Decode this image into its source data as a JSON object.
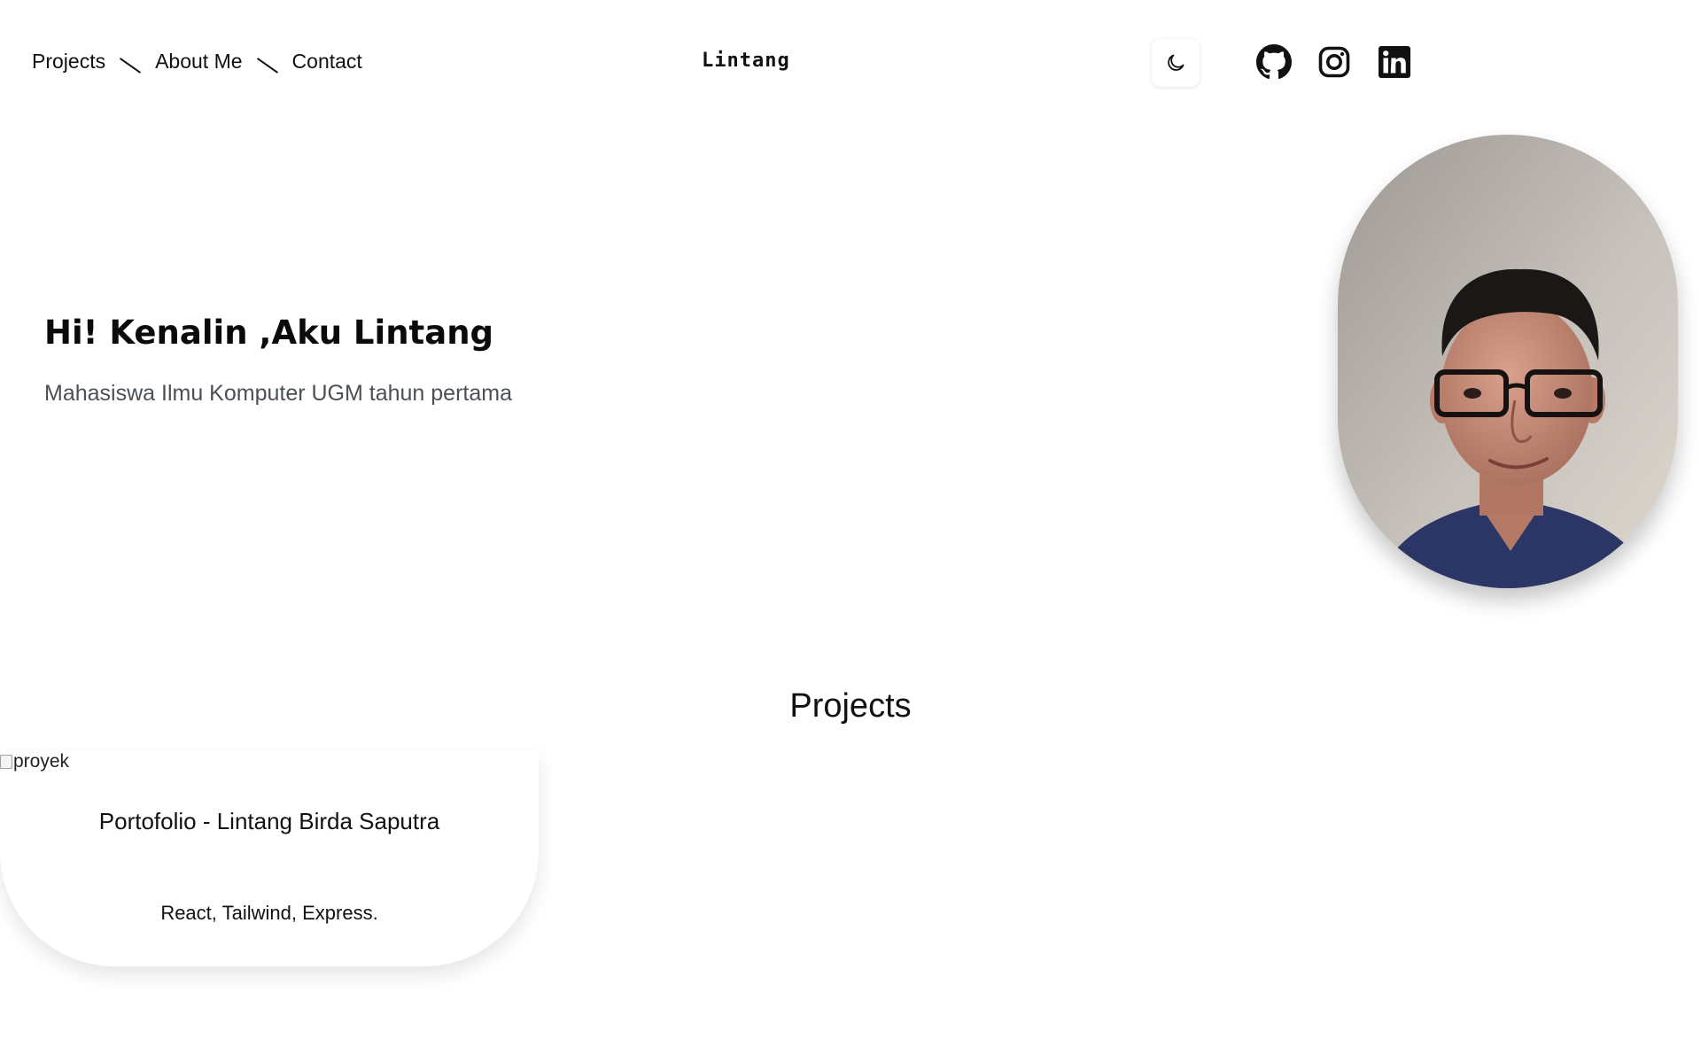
{
  "nav": {
    "links": [
      "Projects",
      "About Me",
      "Contact"
    ],
    "brand": "Lintang",
    "theme_toggle_icon": "moon-icon",
    "socials": [
      "github-icon",
      "instagram-icon",
      "linkedin-icon"
    ]
  },
  "hero": {
    "title": "Hi! Kenalin ,Aku Lintang",
    "subtitle": "Mahasiswa Ilmu Komputer UGM tahun pertama",
    "avatar_icon": "profile-photo"
  },
  "projects": {
    "heading": "Projects",
    "items": [
      {
        "image_alt": "proyek",
        "title": "Portofolio - Lintang Birda Saputra",
        "tech": "React, Tailwind, Express."
      }
    ]
  },
  "colors": {
    "text": "#111111",
    "subtitle": "#4b4f56",
    "background": "#ffffff",
    "shirt": "#2c3666"
  }
}
